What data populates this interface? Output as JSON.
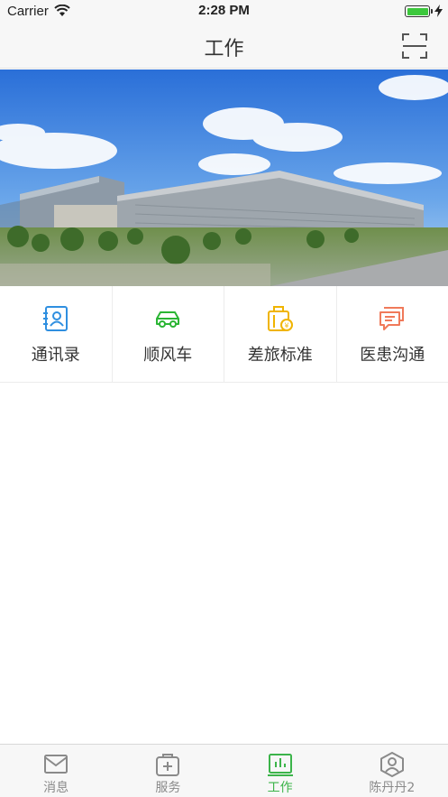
{
  "status_bar": {
    "carrier": "Carrier",
    "time": "2:28 PM",
    "battery_level": 1.0
  },
  "nav": {
    "title": "工作",
    "scan_icon": "scan-icon"
  },
  "grid": [
    {
      "label": "通讯录",
      "icon": "contacts-icon",
      "color": "#2f8fe0"
    },
    {
      "label": "顺风车",
      "icon": "car-icon",
      "color": "#2bb534"
    },
    {
      "label": "差旅标准",
      "icon": "luggage-icon",
      "color": "#f0b400"
    },
    {
      "label": "医患沟通",
      "icon": "chat-icon",
      "color": "#f07a5a"
    }
  ],
  "tabs": [
    {
      "label": "消息",
      "icon": "message-icon",
      "active": false
    },
    {
      "label": "服务",
      "icon": "medkit-icon",
      "active": false
    },
    {
      "label": "工作",
      "icon": "chart-icon",
      "active": true
    },
    {
      "label": "陈丹丹2",
      "icon": "profile-icon",
      "active": false
    }
  ],
  "colors": {
    "active": "#3cb44a",
    "inactive": "#8a8a8a"
  }
}
